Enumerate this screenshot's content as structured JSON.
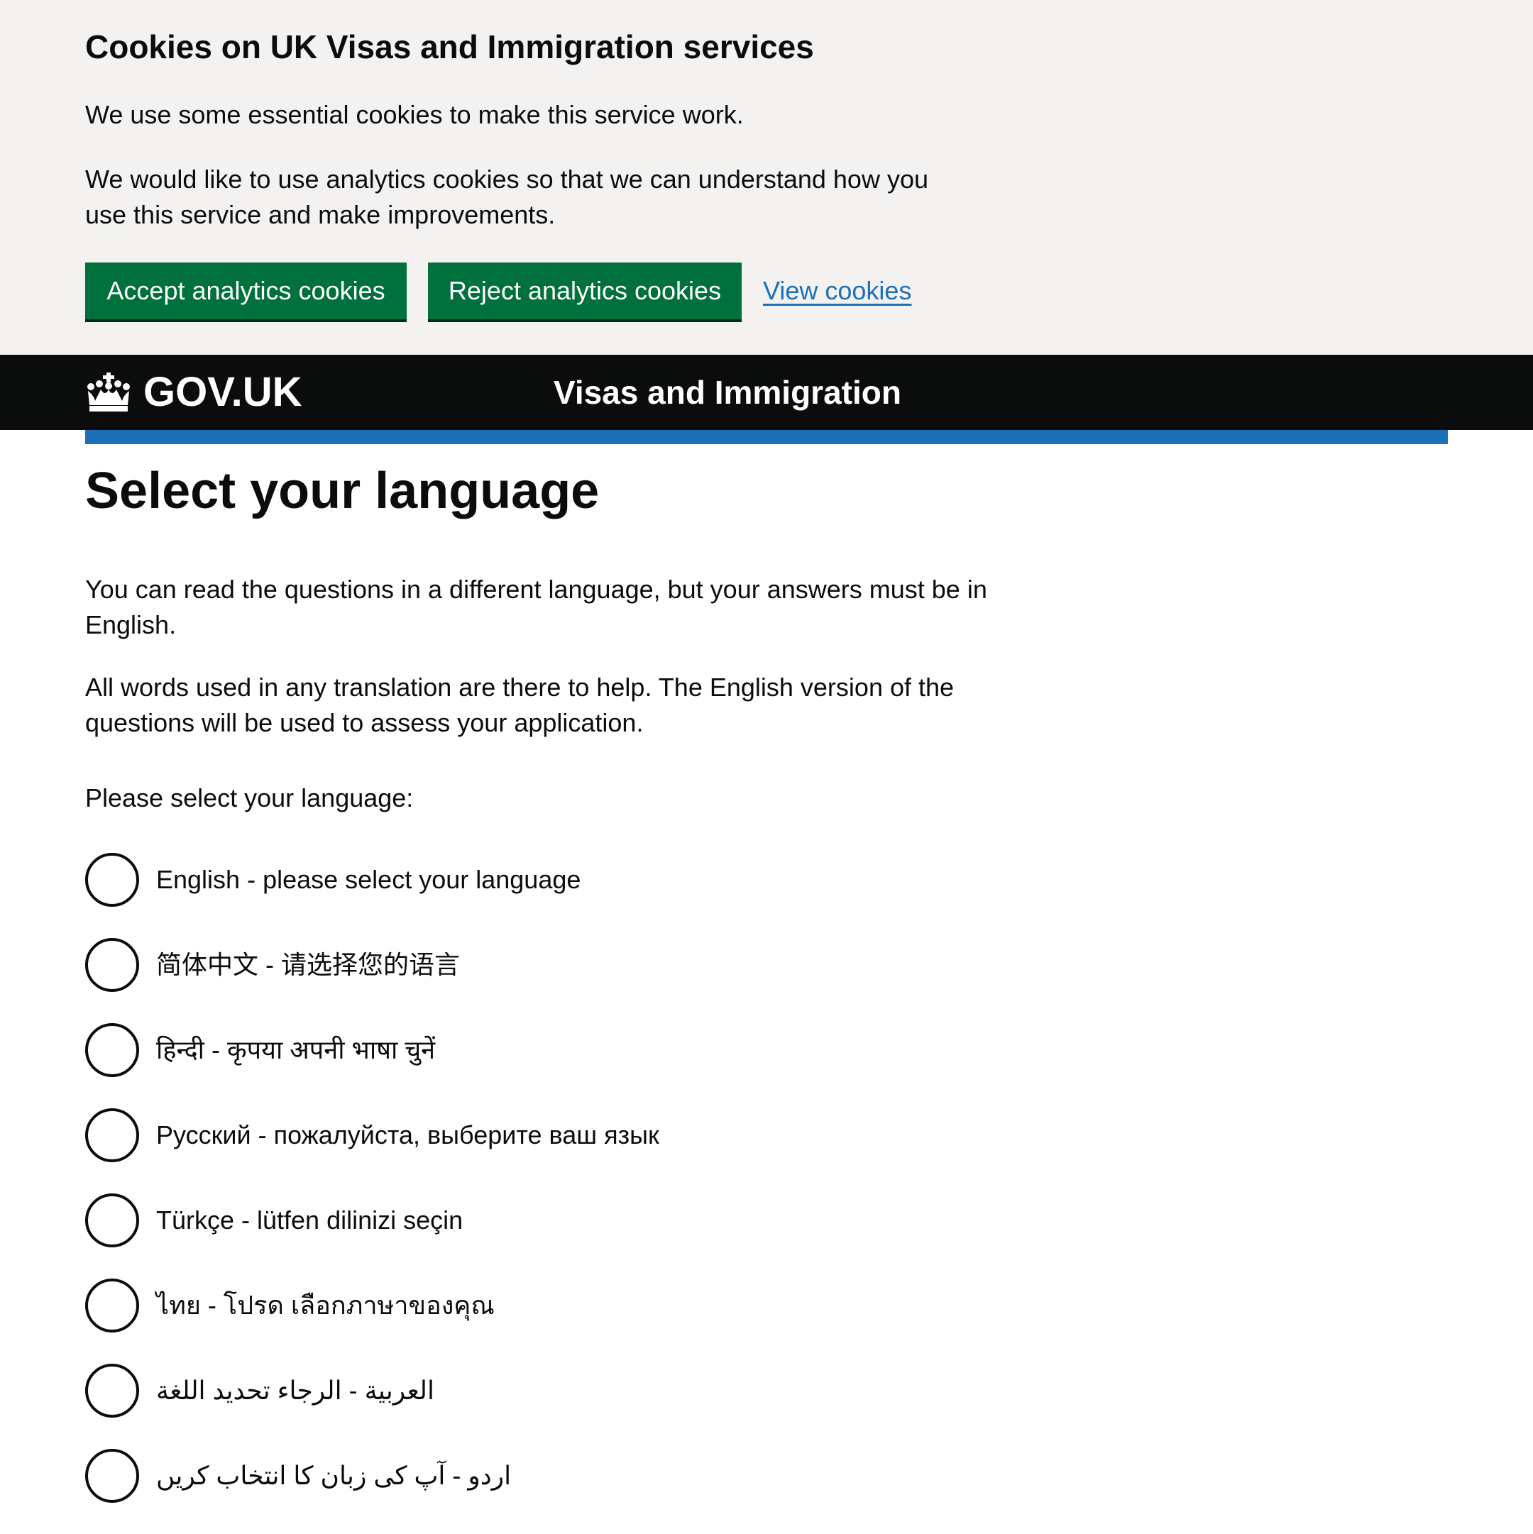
{
  "cookie_banner": {
    "title": "Cookies on UK Visas and Immigration services",
    "paragraph_1": "We use some essential cookies to make this service work.",
    "paragraph_2": "We would like to use analytics cookies so that we can understand how you use this service and make improvements.",
    "accept_label": "Accept analytics cookies",
    "reject_label": "Reject analytics cookies",
    "view_label": "View cookies"
  },
  "header": {
    "logo_text": "GOV.UK",
    "logo_icon": "crown-icon",
    "service_name": "Visas and Immigration"
  },
  "main": {
    "title": "Select your language",
    "paragraph_1": "You can read the questions in a different language, but your answers must be in English.",
    "paragraph_2": "All words used in any translation are there to help. The English version of the questions will be used to assess your application.",
    "prompt": "Please select your language:",
    "languages": [
      {
        "label": "English - please select your language",
        "selected": false
      },
      {
        "label": "简体中文 - 请选择您的语言",
        "selected": false
      },
      {
        "label": "हिन्दी - कृपया अपनी भाषा चुनें",
        "selected": false
      },
      {
        "label": "Русский - пожалуйста, выберите ваш язык",
        "selected": false
      },
      {
        "label": "Türkçe - lütfen dilinizi seçin",
        "selected": false
      },
      {
        "label": "ไทย - โปรด เลือกภาษาของคุณ",
        "selected": false
      },
      {
        "label": "العربية - الرجاء تحديد اللغة",
        "selected": false
      },
      {
        "label": "اردو - آپ کی زبان کا انتخاب کریں",
        "selected": false
      }
    ]
  },
  "colors": {
    "banner_bg": "#f3f2f1",
    "button_green": "#00703c",
    "link_blue": "#1d70b8",
    "header_black": "#0b0c0c",
    "accent_bar": "#1d70b8"
  }
}
